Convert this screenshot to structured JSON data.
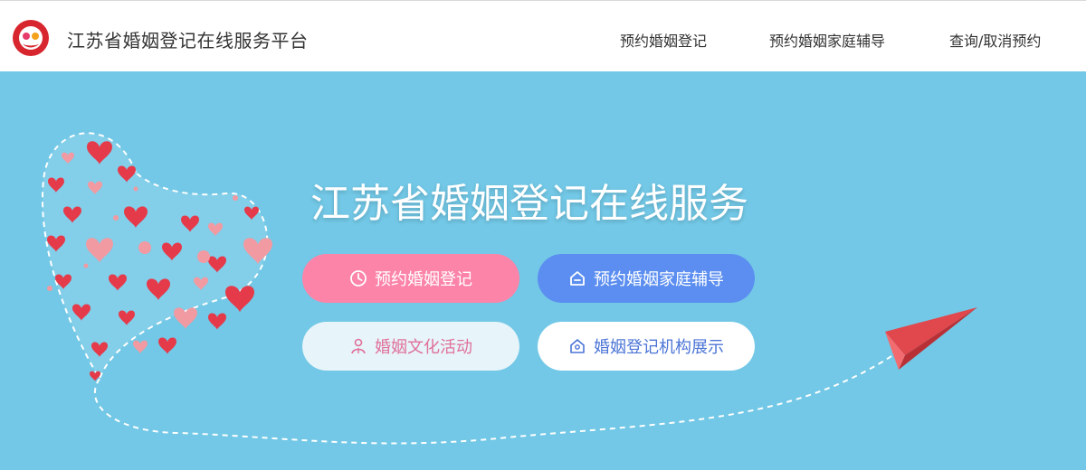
{
  "header": {
    "site_title": "江苏省婚姻登记在线服务平台",
    "nav": [
      {
        "label": "预约婚姻登记"
      },
      {
        "label": "预约婚姻家庭辅导"
      },
      {
        "label": "查询/取消预约"
      }
    ]
  },
  "hero": {
    "title": "江苏省婚姻登记在线服务",
    "buttons": {
      "reserve": {
        "label": "预约婚姻登记",
        "icon": "clock-icon"
      },
      "counsel": {
        "label": "预约婚姻家庭辅导",
        "icon": "house-icon"
      },
      "culture": {
        "label": "婚姻文化活动",
        "icon": "person-icon"
      },
      "org": {
        "label": "婚姻登记机构展示",
        "icon": "building-icon"
      }
    }
  },
  "colors": {
    "hero_bg": "#72c8e6",
    "reserve_btn": "#fc84a8",
    "counsel_btn": "#5b8ef0",
    "heart_red": "#e53a4a",
    "heart_pink": "#f19aa2",
    "plane_red": "#e0484d"
  }
}
